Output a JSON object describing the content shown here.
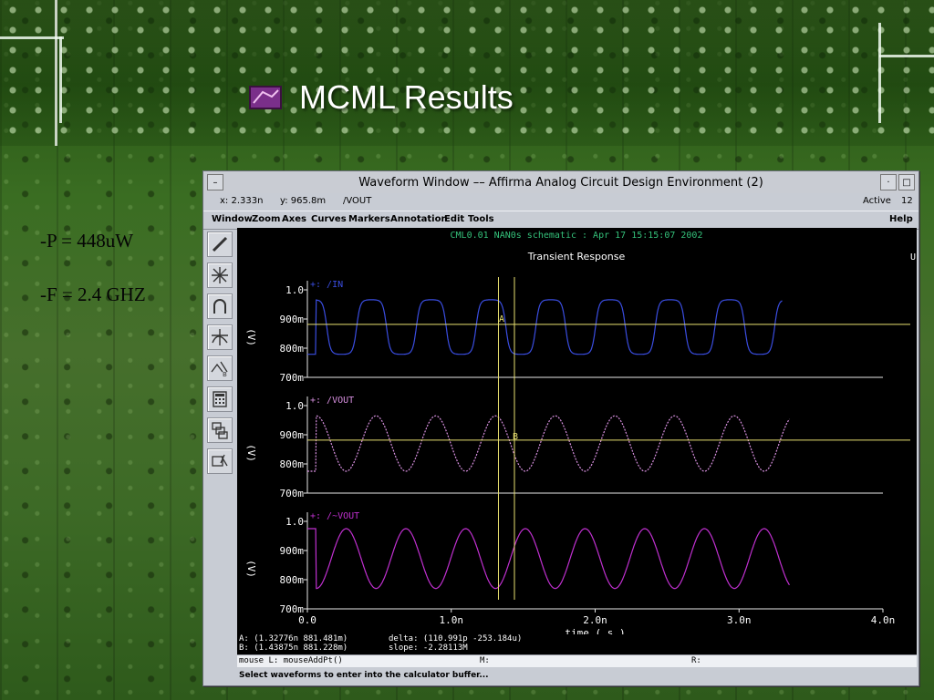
{
  "slide": {
    "title": "MCML Results",
    "bullets": [
      "-P = 448uW",
      "-F = 2.4 GHZ"
    ]
  },
  "window": {
    "title": "Waveform Window –– Affirma Analog Circuit Design Environment (2)",
    "status": {
      "x": "x: 2.333n",
      "y": "y: 965.8m",
      "signal": "/VOUT",
      "active_label": "Active",
      "active_count": "12"
    },
    "menu": [
      "Window",
      "Zoom",
      "Axes",
      "Curves",
      "Markers",
      "Annotation",
      "Edit",
      "Tools"
    ],
    "help": "Help",
    "tools": [
      "pencil-icon",
      "zoom-burst-icon",
      "curve-icon",
      "crossing-icon",
      "cursor-b-icon",
      "calculator-icon",
      "stack-icon",
      "ruler-icon"
    ],
    "header_line": "CML0.01 NAN0s schematic : Apr 17 15:15:07 2002",
    "plot_title": "Transient Response",
    "corner_marker": "U",
    "marker_a": "A",
    "marker_b": "B",
    "readout": {
      "a": "A: (1.32776n 881.481m)",
      "b": "B: (1.43875n 881.228m)",
      "delta": "delta: (110.991p -253.184u)",
      "slope": "slope: -2.28113M"
    },
    "mouse_line": {
      "l": "mouse L: mouseAddPt()",
      "m": "M:",
      "r": "R:"
    },
    "prompt": "Select waveforms to enter into the calculator buffer..."
  },
  "chart_data": [
    {
      "type": "line",
      "series": [
        {
          "name": "/IN",
          "marker_label": "+: /IN",
          "color": "#3a4de0"
        }
      ],
      "ylabel": "(V)",
      "ylim": [
        0.7,
        1.0
      ],
      "yticks": [
        "1.0",
        "900m",
        "800m",
        "700m"
      ],
      "period_ns": 0.415,
      "wave": {
        "high": 0.966,
        "low": 0.779,
        "start_ns": 0.0,
        "end_ns": 3.3,
        "shape": "square-ish"
      }
    },
    {
      "type": "line",
      "series": [
        {
          "name": "/VOUT",
          "marker_label": "+: /VOUT",
          "color": "#d890e0"
        }
      ],
      "ylabel": "(V)",
      "ylim": [
        0.7,
        1.0
      ],
      "yticks": [
        "1.0",
        "900m",
        "800m",
        "700m"
      ],
      "period_ns": 0.415,
      "wave": {
        "high": 0.965,
        "low": 0.775,
        "start_ns": 0.0,
        "end_ns": 3.35,
        "shape": "sine"
      }
    },
    {
      "type": "line",
      "series": [
        {
          "name": "/~VOUT",
          "marker_label": "+: /~VOUT",
          "color": "#c030d0"
        }
      ],
      "ylabel": "(V)",
      "ylim": [
        0.7,
        1.0
      ],
      "yticks": [
        "1.0",
        "900m",
        "800m",
        "700m"
      ],
      "xlabel": "time ( s )",
      "xticks": [
        "0.0",
        "1.0n",
        "2.0n",
        "3.0n",
        "4.0n"
      ],
      "xlim": [
        0,
        4.0
      ],
      "period_ns": 0.415,
      "wave": {
        "high": 0.975,
        "low": 0.77,
        "start_ns": 0.0,
        "end_ns": 3.35,
        "shape": "sine-inverted"
      }
    }
  ],
  "cursors": {
    "vertical_ns": [
      1.328,
      1.439
    ],
    "horizontal_v": 0.8815
  },
  "colors": {
    "grid_axis": "#e8e8e8",
    "header_green": "#34c07a",
    "cursor": "#e8e070",
    "text": "#ffffff"
  }
}
